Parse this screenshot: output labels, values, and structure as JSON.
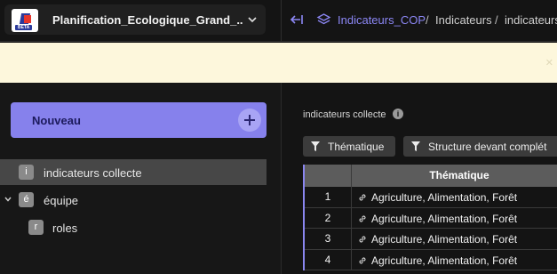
{
  "workspace": {
    "name": "Planification_Ecologique_Grand_...",
    "logo_badge": "BETA"
  },
  "breadcrumb": {
    "root": "Indicateurs_COP",
    "separator": "/",
    "middle": "Indicateurs",
    "current": "indicateurs"
  },
  "sidebar": {
    "new_button": "Nouveau",
    "items": [
      {
        "badge": "i",
        "label": "indicateurs collecte"
      },
      {
        "badge": "é",
        "label": "équipe"
      },
      {
        "badge": "r",
        "label": "roles"
      }
    ]
  },
  "main": {
    "title": "indicateurs collecte",
    "info_icon": "i",
    "filters": [
      "Thématique",
      "Structure devant complét"
    ],
    "table": {
      "header": "Thématique",
      "rows": [
        {
          "num": "1",
          "value": "Agriculture, Alimentation, Forêt"
        },
        {
          "num": "2",
          "value": "Agriculture, Alimentation, Forêt"
        },
        {
          "num": "3",
          "value": "Agriculture, Alimentation, Forêt"
        },
        {
          "num": "4",
          "value": "Agriculture, Alimentation, Forêt"
        }
      ]
    }
  },
  "colors": {
    "accent": "#8681ec",
    "banner": "#fdf7dc",
    "link": "#8c87f5"
  }
}
